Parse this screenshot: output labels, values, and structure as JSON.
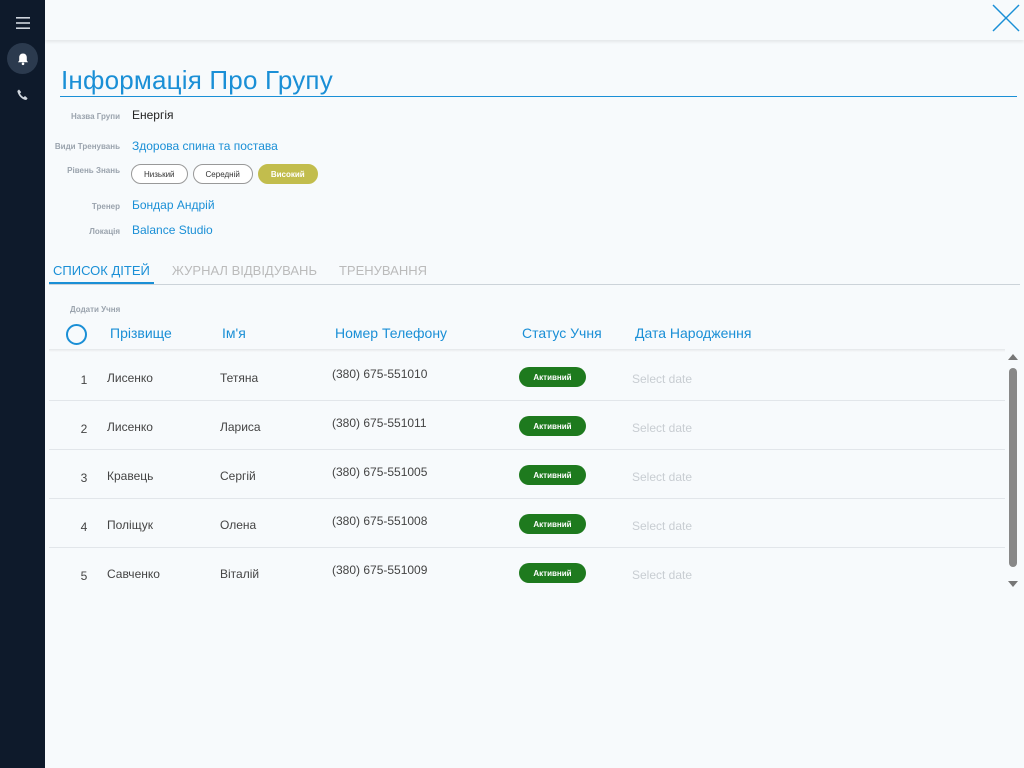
{
  "sidebar": {
    "icons": [
      "menu-icon",
      "bell-icon",
      "phone-icon"
    ]
  },
  "header": {
    "close_icon": "close-icon"
  },
  "page": {
    "title": "Інформація Про Групу"
  },
  "info": {
    "group_name_label": "Назва Групи",
    "group_name": "Енергія",
    "training_types_label": "Види Тренувань",
    "training_types": "Здорова спина та постава",
    "level_label": "Рівень Знань",
    "levels": [
      "Низький",
      "Середній",
      "Високий"
    ],
    "selected_level": "Високий",
    "coach_label": "Тренер",
    "coach": "Бондар Андрій",
    "location_label": "Локація",
    "location": "Balance Studio"
  },
  "tabs": [
    {
      "label": "СПИСОК ДІТЕЙ",
      "active": true
    },
    {
      "label": "ЖУРНАЛ ВІДВІДУВАНЬ",
      "active": false
    },
    {
      "label": "ТРЕНУВАННЯ",
      "active": false
    }
  ],
  "table": {
    "add_student": "Додати Учня",
    "columns": {
      "last_name": "Прізвище",
      "first_name": "Ім'я",
      "phone": "Номер Телефону",
      "status": "Статус Учня",
      "birth_date": "Дата Народження"
    },
    "rows": [
      {
        "num": "1",
        "last_name": "Лисенко",
        "first_name": "Тетяна",
        "phone": "(380) 675-551010",
        "status": "Активний",
        "date": "Select date"
      },
      {
        "num": "2",
        "last_name": "Лисенко",
        "first_name": "Лариса",
        "phone": "(380) 675-551011",
        "status": "Активний",
        "date": "Select date"
      },
      {
        "num": "3",
        "last_name": "Кравець",
        "first_name": "Сергій",
        "phone": "(380) 675-551005",
        "status": "Активний",
        "date": "Select date"
      },
      {
        "num": "4",
        "last_name": "Поліщук",
        "first_name": "Олена",
        "phone": "(380) 675-551008",
        "status": "Активний",
        "date": "Select date"
      },
      {
        "num": "5",
        "last_name": "Савченко",
        "first_name": "Віталій",
        "phone": "(380) 675-551009",
        "status": "Активний",
        "date": "Select date"
      }
    ]
  },
  "colors": {
    "accent": "#1a8fd6",
    "sidebar_bg": "#0e1a2b",
    "level_active": "#c2bd4d",
    "status_active": "#1e7a1e"
  }
}
